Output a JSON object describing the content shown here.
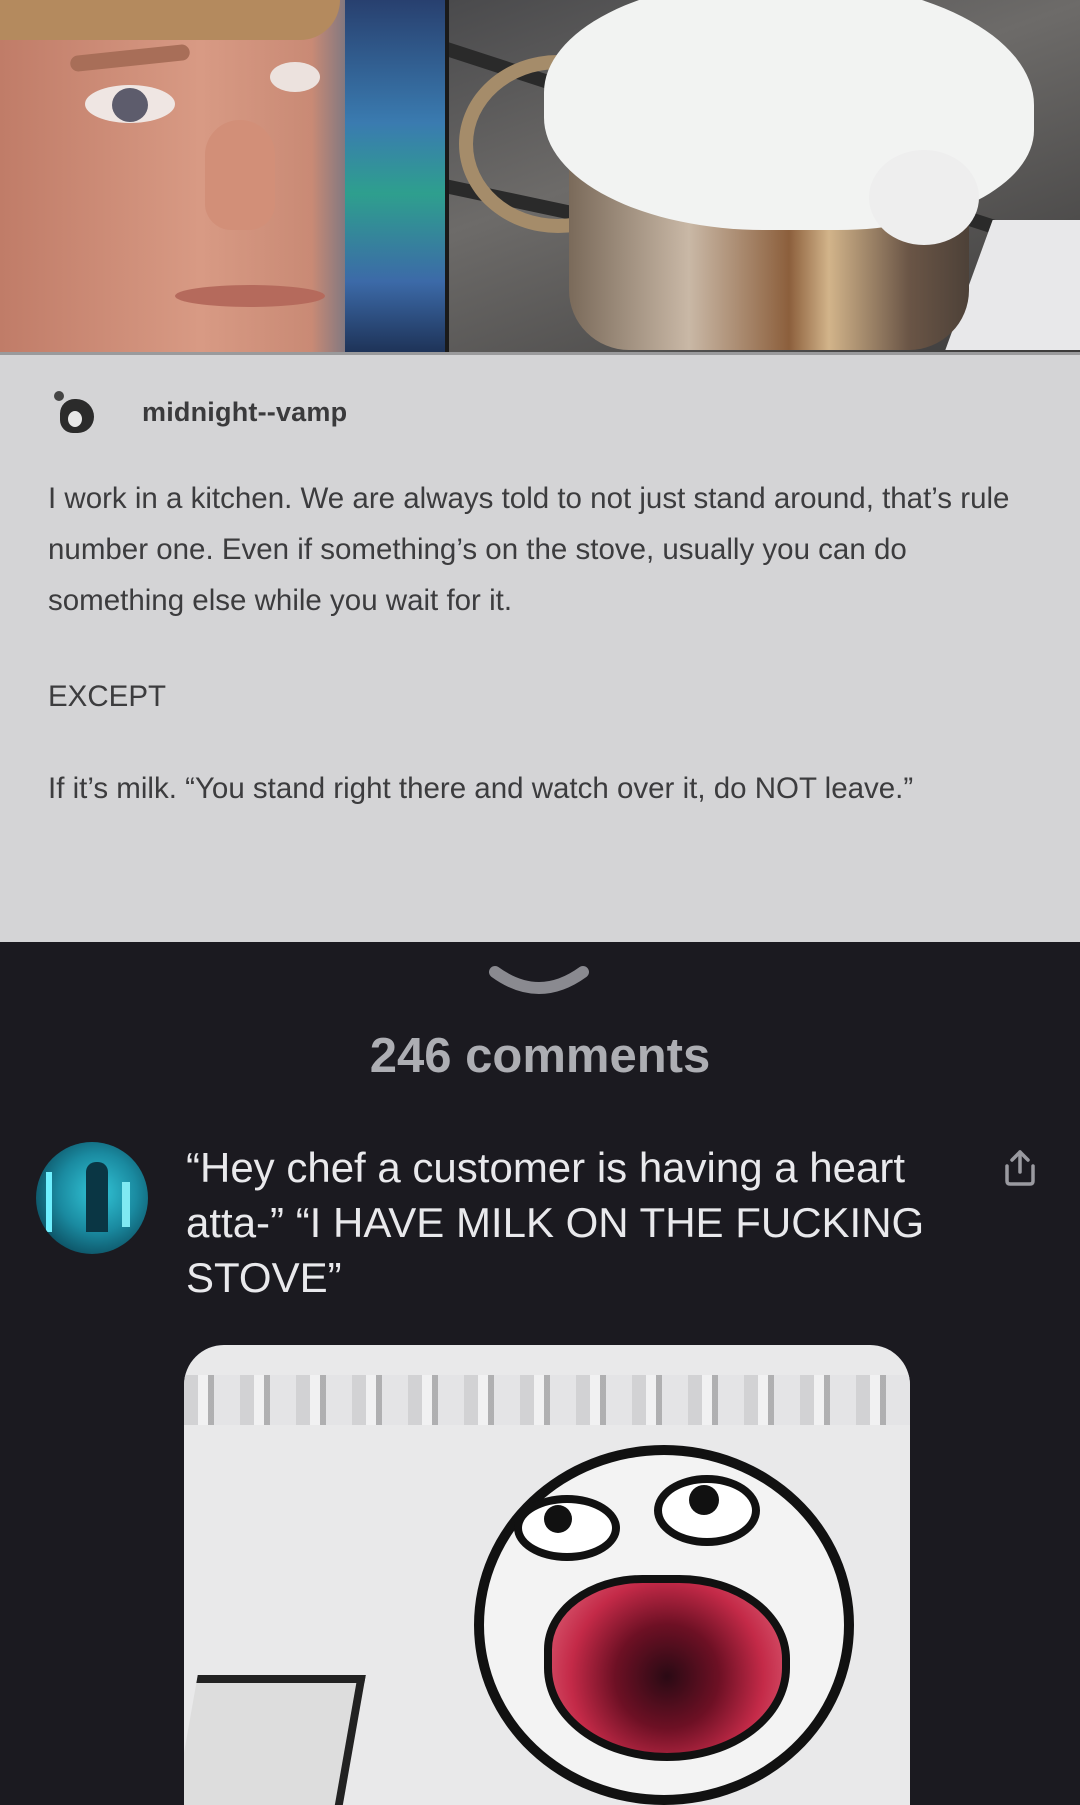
{
  "post": {
    "username": "midnight--vamp",
    "paragraph1": "I work in a kitchen. We are always told to not just stand around, that’s rule number one. Even if something’s on the stove, usually you can do something else while you wait for it.",
    "paragraph2": "EXCEPT",
    "paragraph3": "If it’s milk. “You stand right there and watch over it, do NOT leave.”"
  },
  "comments": {
    "count_label": "246 comments",
    "items": [
      {
        "text": "“Hey chef a customer is having a heart atta-” “I HAVE MILK ON THE FUCKING STOVE”"
      }
    ]
  },
  "icons": {
    "collapse": "chevron-down-icon",
    "share": "share-icon"
  },
  "colors": {
    "background": "#1b1a20",
    "comment_text": "#e9e9ec",
    "comments_count": "#adaeb3"
  }
}
